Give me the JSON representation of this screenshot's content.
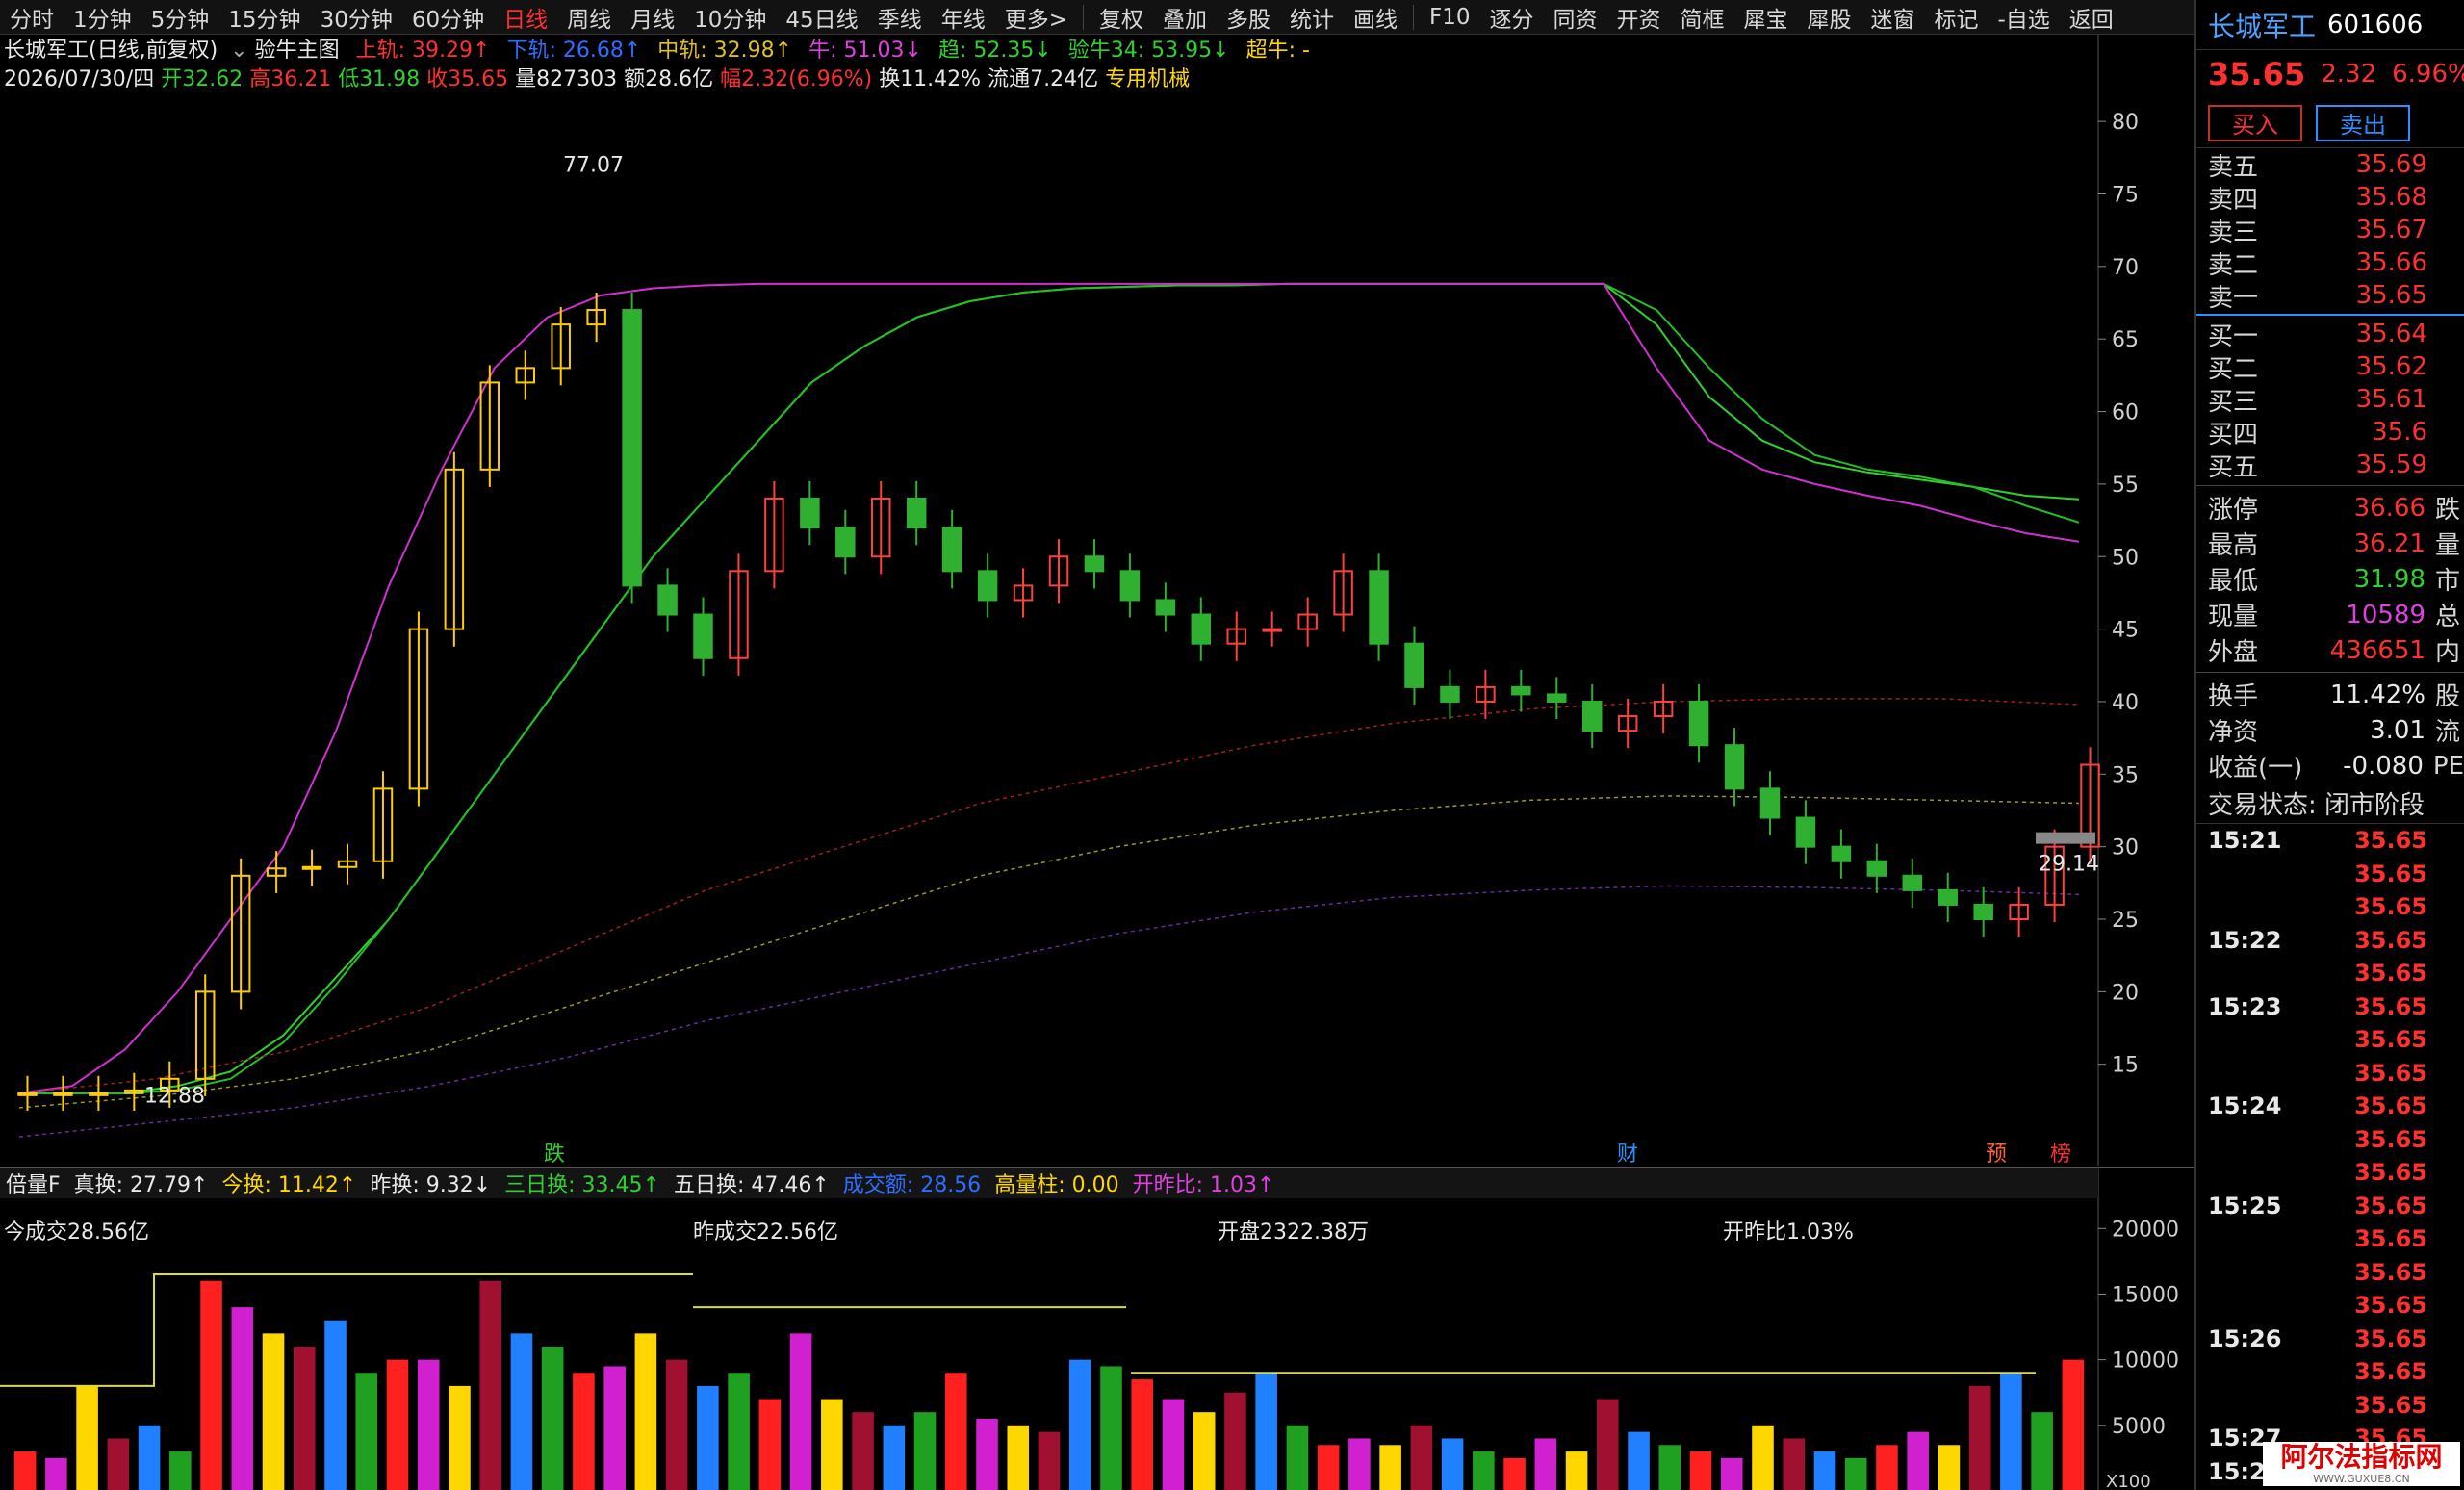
{
  "toolbar": {
    "items": [
      "分时",
      "1分钟",
      "5分钟",
      "15分钟",
      "30分钟",
      "60分钟",
      "日线",
      "周线",
      "月线",
      "10分钟",
      "45日线",
      "季线",
      "年线",
      "更多>",
      "复权",
      "叠加",
      "多股",
      "统计",
      "画线",
      "F10",
      "逐分",
      "同资",
      "开资",
      "简框",
      "犀宝",
      "犀股",
      "迷窗",
      "标记",
      "-自选",
      "返回"
    ],
    "active": "日线"
  },
  "header": {
    "stock_title": "长城军工(日线,前复权)",
    "indicator_name": "验牛主图",
    "upper": "上轨: 39.29↑",
    "lower": "下轨: 26.68↑",
    "middle": "中轨: 32.98↑",
    "bull": "牛: 51.03↓",
    "trend": "趋: 52.35↓",
    "yanniu34": "验牛34: 53.95↓",
    "super_bull": "超牛: -",
    "date": "2026/07/30/四",
    "open": "开32.62",
    "high": "高36.21",
    "low": "低31.98",
    "close": "收35.65",
    "volume": "量827303",
    "amount": "额28.6亿",
    "change": "幅2.32(6.96%)",
    "turnover": "换11.42%",
    "float": "流通7.24亿",
    "sector": "专用机械"
  },
  "main_annotations": {
    "max_label": "77.07",
    "min_label": "12.88",
    "last_label": "29.14",
    "markers": [
      "跌",
      "财",
      "预",
      "榜"
    ]
  },
  "volume_header": {
    "name": "倍量F",
    "true_turnover": "真换: 27.79↑",
    "today_turnover": "今换: 11.42↑",
    "yest_turnover": "昨换: 9.32↓",
    "three_day": "三日换: 33.45↑",
    "five_day": "五日换: 47.46↑",
    "amount_label": "成交额: 28.56",
    "high_bar": "高量柱: 0.00",
    "open_ratio": "开昨比: 1.03↑"
  },
  "volume_annotations": {
    "today_amount": "今成交28.56亿",
    "yest_amount": "昨成交22.56亿",
    "open_amount": "开盘2322.38万",
    "open_ratio_text": "开昨比1.03%",
    "unit_label": "X100"
  },
  "right_panel": {
    "name": "长城军工",
    "code": "601606",
    "price": "35.65",
    "change": "2.32",
    "change_pct": "6.96%",
    "buy_label": "买入",
    "sell_label": "卖出",
    "sells": [
      [
        "卖五",
        35.69
      ],
      [
        "卖四",
        35.68
      ],
      [
        "卖三",
        35.67
      ],
      [
        "卖二",
        35.66
      ],
      [
        "卖一",
        35.65
      ]
    ],
    "buys": [
      [
        "买一",
        35.64
      ],
      [
        "买二",
        35.62
      ],
      [
        "买三",
        35.61
      ],
      [
        "买四",
        35.6
      ],
      [
        "买五",
        35.59
      ]
    ],
    "stats": [
      {
        "label": "涨停",
        "value": "36.66",
        "color": "#ff3030",
        "cut": "跌"
      },
      {
        "label": "最高",
        "value": "36.21",
        "color": "#ff3030",
        "cut": "量"
      },
      {
        "label": "最低",
        "value": "31.98",
        "color": "#30d030",
        "cut": "市"
      },
      {
        "label": "现量",
        "value": "10589",
        "color": "#e040e0",
        "cut": "总"
      },
      {
        "label": "外盘",
        "value": "436651",
        "color": "#ff3030",
        "cut": "内"
      },
      {
        "label": "换手",
        "value": "11.42%",
        "color": "#e8e8e8",
        "cut": "股"
      },
      {
        "label": "净资",
        "value": "3.01",
        "color": "#e8e8e8",
        "cut": "流"
      },
      {
        "label": "收益(一)",
        "value": "-0.080",
        "color": "#e8e8e8",
        "cut": "PE"
      }
    ],
    "trade_status": "交易状态: 闭市阶段",
    "ticks": [
      [
        "15:21",
        "35.65"
      ],
      [
        "",
        "35.65"
      ],
      [
        "",
        "35.65"
      ],
      [
        "15:22",
        "35.65"
      ],
      [
        "",
        "35.65"
      ],
      [
        "15:23",
        "35.65"
      ],
      [
        "",
        "35.65"
      ],
      [
        "",
        "35.65"
      ],
      [
        "15:24",
        "35.65"
      ],
      [
        "",
        "35.65"
      ],
      [
        "",
        "35.65"
      ],
      [
        "15:25",
        "35.65"
      ],
      [
        "",
        "35.65"
      ],
      [
        "",
        "35.65"
      ],
      [
        "",
        "35.65"
      ],
      [
        "15:26",
        "35.65"
      ],
      [
        "",
        "35.65"
      ],
      [
        "",
        "35.65"
      ],
      [
        "15:27",
        "35.65"
      ],
      [
        "15:2",
        ""
      ]
    ]
  },
  "watermark": {
    "title": "阿尔法指标网",
    "url": "WWW.GUXUE8.CN"
  },
  "chart_data": [
    {
      "type": "candlestick",
      "title": "长城军工(日线,前复权)",
      "y_ticks": [
        15,
        20,
        25,
        30,
        35,
        40,
        45,
        50,
        55,
        60,
        65,
        70,
        75,
        80
      ],
      "ylim": [
        11,
        82
      ],
      "series": [
        {
          "name": "验牛34",
          "values": [
            13,
            13,
            13,
            13.5,
            14.5,
            17,
            21,
            25,
            30,
            35,
            40,
            45,
            50,
            54,
            58,
            62,
            64.5,
            66.5,
            67.6,
            68.2,
            68.5,
            68.6,
            68.7,
            68.7,
            68.8,
            68.8,
            68.8,
            68.8,
            68.8,
            68.8,
            68.8,
            66,
            61,
            58,
            56.5,
            55.8,
            55.3,
            54.8,
            54.2,
            53.95
          ]
        },
        {
          "name": "趋",
          "values": [
            13,
            13,
            13,
            13.2,
            14,
            16.5,
            20.5,
            25,
            30,
            35,
            40,
            45,
            50,
            54,
            58,
            62,
            64.5,
            66.5,
            67.6,
            68.2,
            68.5,
            68.6,
            68.7,
            68.7,
            68.8,
            68.8,
            68.8,
            68.8,
            68.8,
            68.8,
            68.8,
            67,
            63,
            59.5,
            57,
            56,
            55.5,
            54.8,
            53.5,
            52.35
          ]
        },
        {
          "name": "牛",
          "values": [
            13,
            13.5,
            16,
            20,
            25,
            30,
            38,
            48,
            56,
            63,
            66.5,
            68,
            68.5,
            68.7,
            68.8,
            68.8,
            68.8,
            68.8,
            68.8,
            68.8,
            68.8,
            68.8,
            68.8,
            68.8,
            68.8,
            68.8,
            68.8,
            68.8,
            68.8,
            68.8,
            68.8,
            63,
            58,
            56,
            55,
            54.2,
            53.5,
            52.5,
            51.6,
            51.03
          ]
        }
      ],
      "closes": [
        13,
        13,
        13,
        13.2,
        14,
        20,
        28,
        28.5,
        28.6,
        29,
        34,
        45,
        56,
        62,
        63,
        66,
        67,
        48,
        46,
        43,
        49,
        54,
        52,
        50,
        54,
        52,
        49,
        47,
        48,
        50,
        49,
        47,
        46,
        44,
        45,
        45,
        46,
        49,
        44,
        41,
        40,
        41,
        40.5,
        40,
        38,
        39,
        40,
        37,
        34,
        32,
        30,
        29,
        28,
        27,
        26,
        25,
        26,
        30,
        35.65
      ]
    },
    {
      "type": "bar",
      "title": "倍量F",
      "y_ticks": [
        5000,
        10000,
        15000,
        20000
      ],
      "ylim": [
        0,
        22000
      ],
      "values": [
        3000,
        2500,
        8000,
        4000,
        5000,
        3000,
        16000,
        14000,
        12000,
        11000,
        13000,
        9000,
        10000,
        10000,
        8000,
        16000,
        12000,
        11000,
        9000,
        9500,
        12000,
        10000,
        8000,
        9000,
        7000,
        12000,
        7000,
        6000,
        5000,
        6000,
        9000,
        5500,
        5000,
        4500,
        10000,
        9500,
        8500,
        7000,
        6000,
        7500,
        9000,
        5000,
        3500,
        4000,
        3500,
        5000,
        4000,
        3000,
        2500,
        4000,
        3000,
        7000,
        4500,
        3500,
        3000,
        2500,
        5000,
        4000,
        3000,
        2500,
        3500,
        4500,
        3500,
        8000,
        9000,
        6000,
        10000
      ]
    }
  ]
}
